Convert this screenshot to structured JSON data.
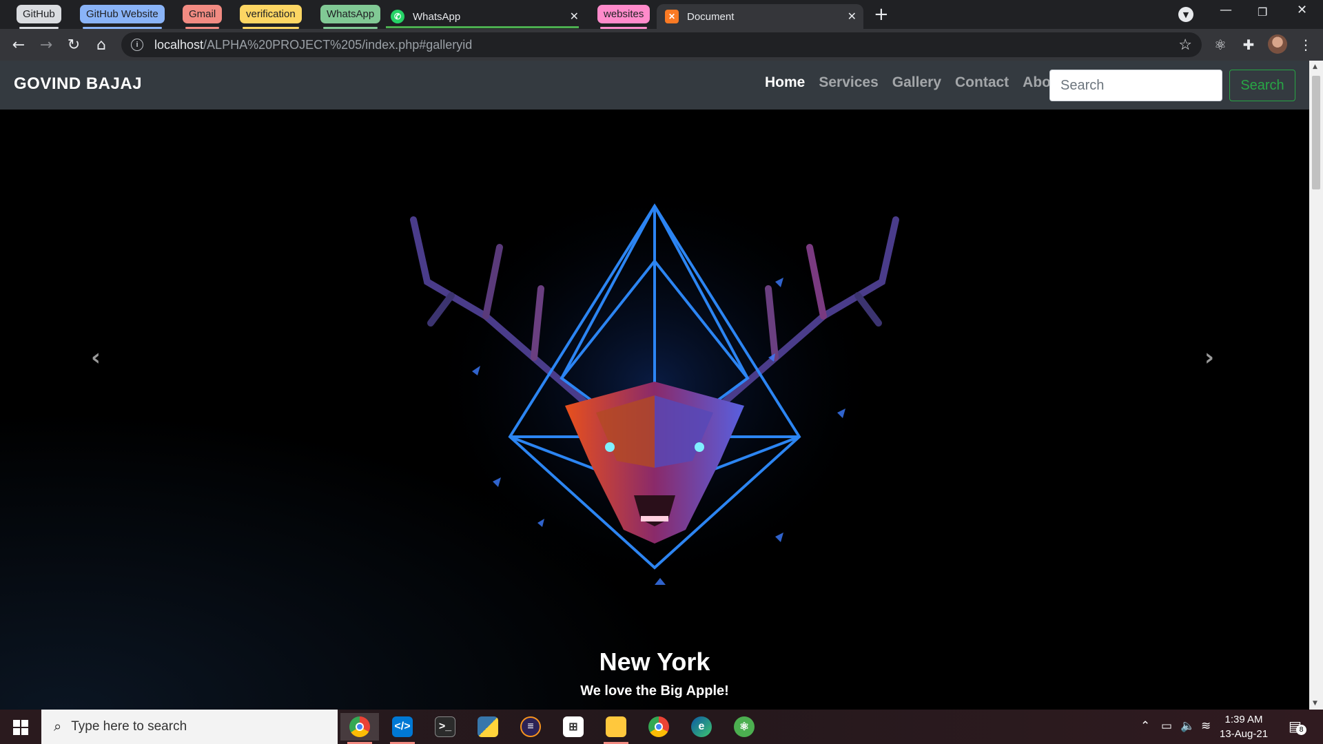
{
  "browser": {
    "tab_groups": [
      {
        "label": "GitHub",
        "color": "#dadce0"
      },
      {
        "label": "GitHub Website",
        "color": "#8ab4f8"
      },
      {
        "label": "Gmail",
        "color": "#f28b82"
      },
      {
        "label": "verification",
        "color": "#fdd663"
      },
      {
        "label": "WhatsApp",
        "color": "#81c995"
      },
      {
        "label": "websites",
        "color": "#ff8bcb"
      }
    ],
    "tabs": [
      {
        "title": "WhatsApp",
        "icon": "whatsapp-icon"
      },
      {
        "title": "Document",
        "icon": "xampp-icon",
        "active": true
      }
    ],
    "url_host": "localhost",
    "url_path": "/ALPHA%20PROJECT%205/index.php#galleryid"
  },
  "navbar": {
    "brand": "GOVIND BAJAJ",
    "links": [
      "Home",
      "Services",
      "Gallery",
      "Contact",
      "About"
    ],
    "active_link": "Home",
    "search_placeholder": "Search",
    "search_button": "Search",
    "accent_color": "#28a745"
  },
  "carousel": {
    "caption_title": "New York",
    "caption_text": "We love the Big Apple!",
    "slide_count": 3,
    "active_index": 2,
    "prev_icon": "chevron-left-icon",
    "next_icon": "chevron-right-icon"
  },
  "taskbar": {
    "search_placeholder": "Type here to search",
    "time": "1:39 AM",
    "date": "13-Aug-21",
    "notification_count": "8"
  }
}
